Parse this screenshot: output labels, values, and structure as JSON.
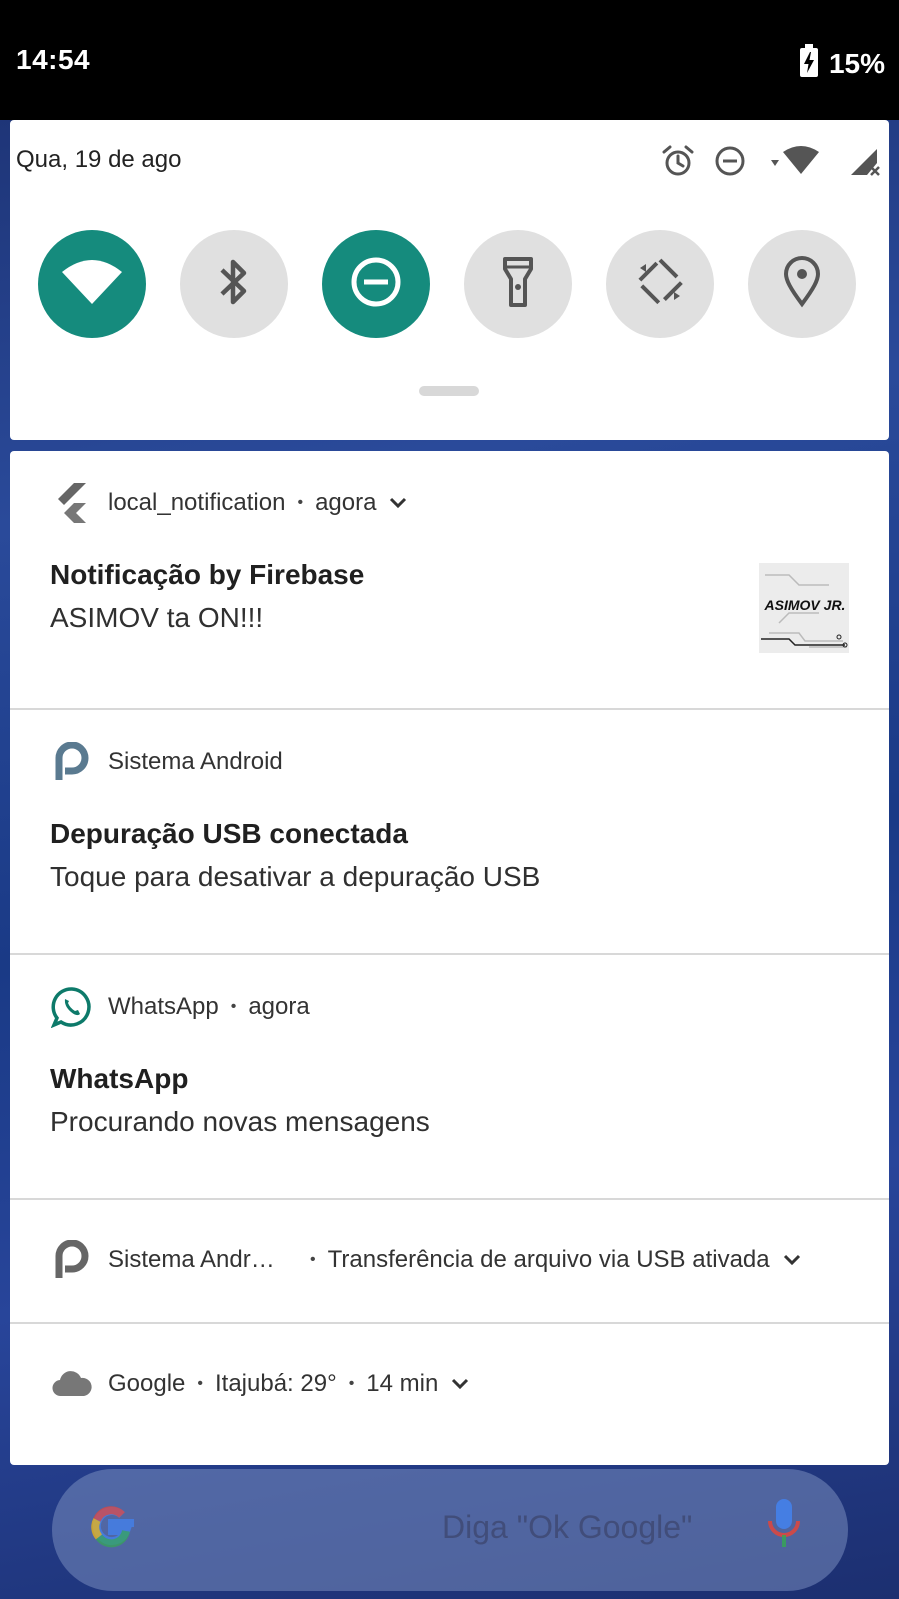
{
  "status_bar": {
    "time": "14:54",
    "battery_percent": "15%",
    "battery_level": 0.15,
    "battery_charging": true
  },
  "quick_settings": {
    "date": "Qua, 19 de ago",
    "status_icons": [
      "alarm-icon",
      "do-not-disturb-icon",
      "wifi-signal-icon",
      "cell-signal-icon"
    ],
    "tiles": [
      {
        "name": "wifi",
        "icon": "wifi-icon",
        "active": true
      },
      {
        "name": "bluetooth",
        "icon": "bluetooth-icon",
        "active": false
      },
      {
        "name": "do-not-disturb",
        "icon": "do-not-disturb-icon",
        "active": true
      },
      {
        "name": "flashlight",
        "icon": "flashlight-icon",
        "active": false
      },
      {
        "name": "auto-rotate",
        "icon": "auto-rotate-icon",
        "active": false
      },
      {
        "name": "location",
        "icon": "location-icon",
        "active": false
      }
    ],
    "active_color": "#158b7d",
    "inactive_color": "#e0e0e0"
  },
  "notifications": [
    {
      "app": "local_notification",
      "time": "agora",
      "title": "Notificação by Firebase",
      "text": "ASIMOV ta ON!!!",
      "icon": "flutter-icon",
      "thumbnail_text": "ASIMOV JR."
    },
    {
      "app": "Sistema Android",
      "title": "Depuração USB conectada",
      "text": "Toque para desativar a depuração USB",
      "icon": "android-p-icon"
    },
    {
      "app": "WhatsApp",
      "time": "agora",
      "title": "WhatsApp",
      "text": "Procurando novas mensagens",
      "icon": "whatsapp-icon",
      "accent": "#0d7a6a"
    },
    {
      "app": "Sistema Andr…",
      "summary": "Transferência de arquivo via USB ativada",
      "icon": "android-p-icon"
    },
    {
      "app": "Google",
      "summary": "Itajubá: 29°",
      "time": "14 min",
      "icon": "cloud-icon"
    }
  ],
  "google_search": {
    "hint": "Diga \"Ok Google\""
  }
}
